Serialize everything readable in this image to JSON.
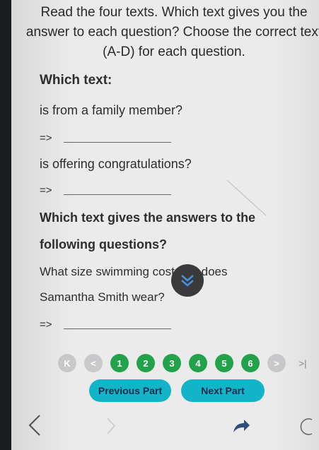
{
  "instructions": "Read the four texts. Which text gives you the answer to each question? Choose the correct text (A-D) for each question.",
  "section1": {
    "heading": "Which text:",
    "questions": [
      {
        "text": "is from a family member?",
        "arrow": "=>"
      },
      {
        "text": "is offering congratulations?",
        "arrow": "=>"
      }
    ]
  },
  "section2": {
    "heading_line1": "Which text gives the answers to the",
    "heading_line2": "following questions?",
    "question_line1": "What size swimming costume does",
    "question_line2": "Samantha Smith wear?",
    "arrow": "=>"
  },
  "pagination": {
    "first": "K",
    "prev": "<",
    "pages": [
      "1",
      "2",
      "3",
      "4",
      "5",
      "6"
    ],
    "next": ">",
    "last": ">|"
  },
  "buttons": {
    "previous": "Previous Part",
    "next": "Next Part"
  },
  "colors": {
    "page_green": "#22a24a",
    "button_cyan": "#12b5c8",
    "nav_grey": "#c9c9cc"
  }
}
